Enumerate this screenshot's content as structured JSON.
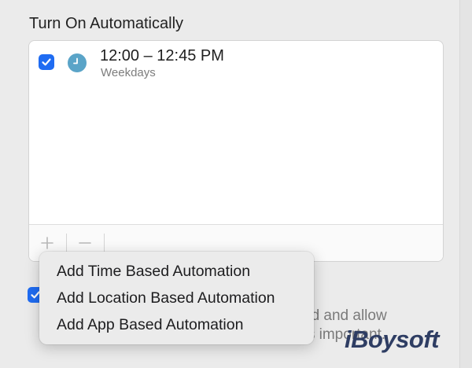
{
  "section": {
    "title": "Turn On Automatically"
  },
  "schedule": {
    "items": [
      {
        "time": "12:00 – 12:45 PM",
        "days": "Weekdays",
        "checked": true,
        "icon": "clock-icon"
      }
    ]
  },
  "toolbar": {
    "add_label": "+",
    "remove_label": "−"
  },
  "menu": {
    "items": [
      {
        "label": "Add Time Based Automation"
      },
      {
        "label": "Add Location Based Automation"
      },
      {
        "label": "Add App Based Automation"
      }
    ]
  },
  "description": {
    "line1": "ed and allow",
    "line2": "ing is important."
  },
  "watermark": {
    "text": "iBoysoft"
  },
  "colors": {
    "accent": "#1f6cf2",
    "clock": "#5aa4c8",
    "panel": "#ebebeb",
    "list_bg": "#ffffff"
  }
}
